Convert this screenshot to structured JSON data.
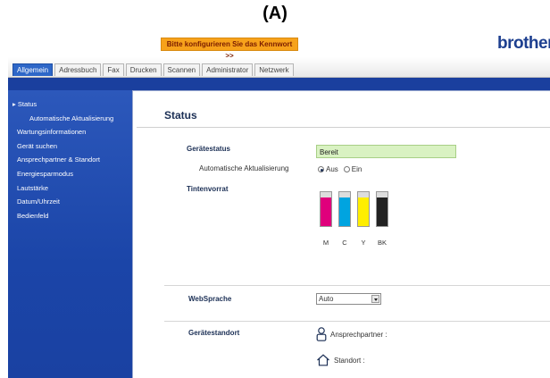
{
  "figure_label": "(A)",
  "header": {
    "password_warning": "Bitte konfigurieren Sie das Kennwort >>",
    "logo_text": "brother"
  },
  "tabs": [
    {
      "label": "Allgemein",
      "active": true
    },
    {
      "label": "Adressbuch",
      "active": false
    },
    {
      "label": "Fax",
      "active": false
    },
    {
      "label": "Drucken",
      "active": false
    },
    {
      "label": "Scannen",
      "active": false
    },
    {
      "label": "Administrator",
      "active": false
    },
    {
      "label": "Netzwerk",
      "active": false
    }
  ],
  "sidebar": {
    "items": [
      {
        "label": "Status",
        "marker": "▸"
      },
      {
        "label": "Automatische Aktualisierung"
      },
      {
        "label": "Wartungsinformationen"
      },
      {
        "label": "Gerät suchen"
      },
      {
        "label": "Ansprechpartner & Standort"
      },
      {
        "label": "Energiesparmodus"
      },
      {
        "label": "Lautstärke"
      },
      {
        "label": "Datum/Uhrzeit"
      },
      {
        "label": "Bedienfeld"
      }
    ]
  },
  "main": {
    "title": "Status",
    "device_status": {
      "label": "Gerätestatus",
      "value": "Bereit",
      "value_bg": "#d9f2c2"
    },
    "auto_update": {
      "label": "Automatische Aktualisierung",
      "options": [
        {
          "label": "Aus",
          "selected": true
        },
        {
          "label": "Ein",
          "selected": false
        }
      ]
    },
    "ink": {
      "label": "Tintenvorrat",
      "cartridges": [
        {
          "name": "M",
          "color": "#e0007c",
          "level": 0.85
        },
        {
          "name": "C",
          "color": "#00a4e0",
          "level": 0.85
        },
        {
          "name": "Y",
          "color": "#ffee00",
          "level": 0.85
        },
        {
          "name": "BK",
          "color": "#222222",
          "level": 0.85
        }
      ]
    },
    "web_language": {
      "label": "WebSprache",
      "value": "Auto"
    },
    "device_location": {
      "label": "Gerätestandort",
      "contact_label": "Ansprechpartner :",
      "location_label": "Standort :"
    }
  },
  "colors": {
    "brand_blue": "#1d3f8f",
    "sidebar_blue": "#1b45a8",
    "warning_orange": "#f7a21b"
  }
}
